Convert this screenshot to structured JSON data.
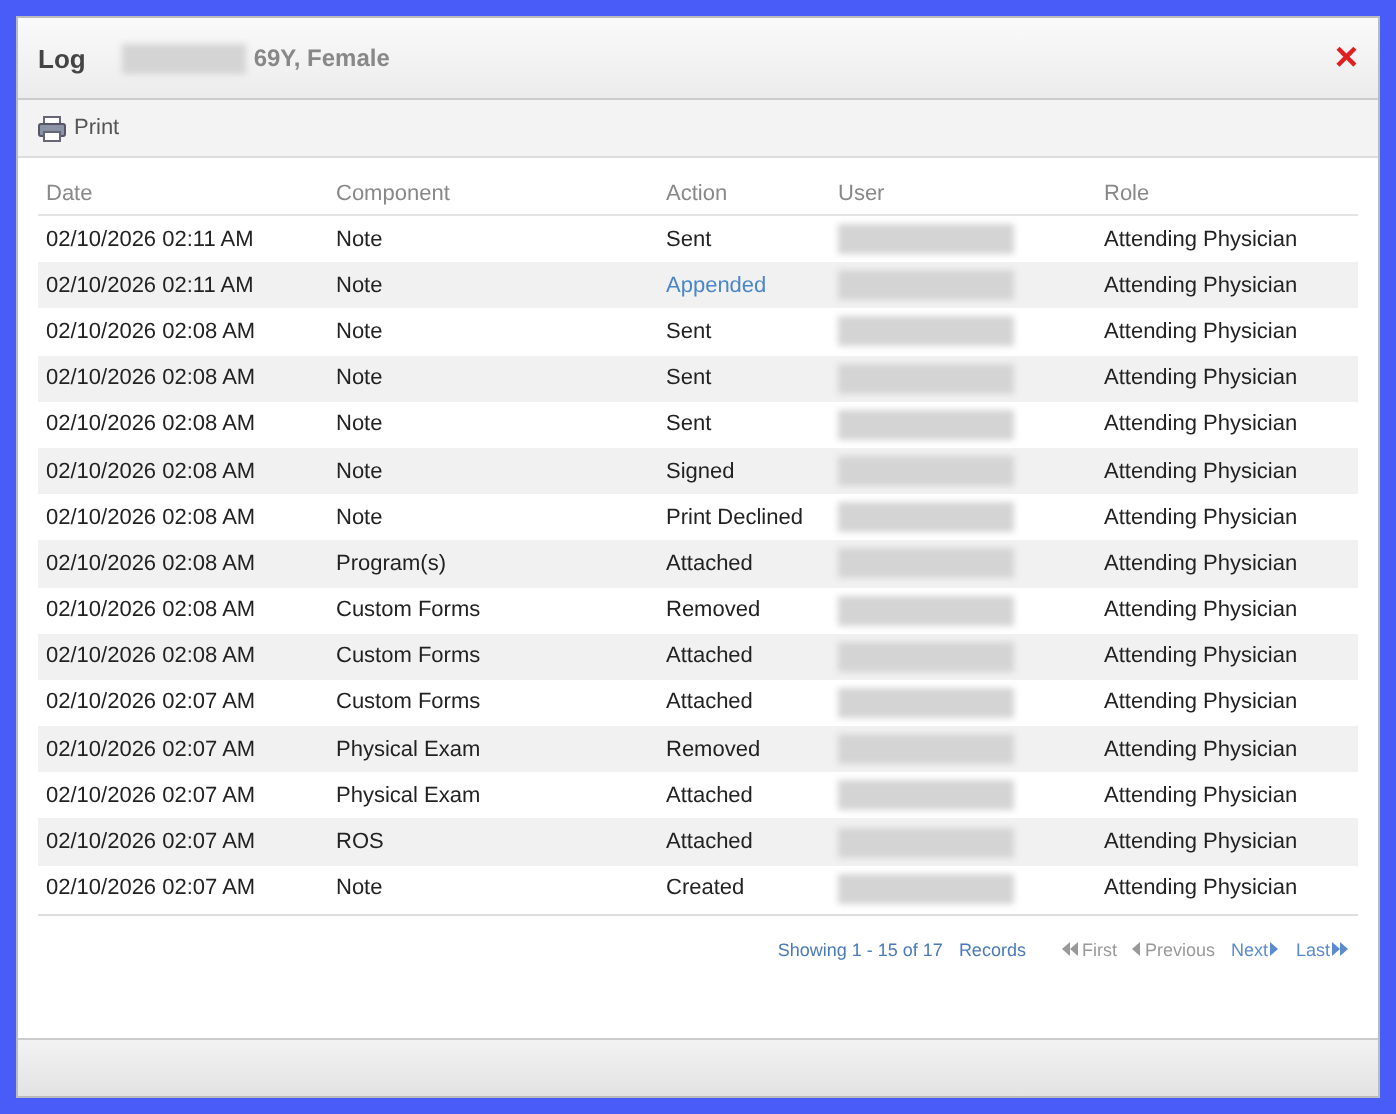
{
  "dialog": {
    "title": "Log",
    "patient": "69Y, Female",
    "close": "×"
  },
  "toolbar": {
    "print": "Print"
  },
  "table": {
    "columns": [
      "Date",
      "Component",
      "Action",
      "User",
      "Role"
    ],
    "rows": [
      {
        "date": "02/10/2026 02:11 AM",
        "component": "Note",
        "action": "Sent",
        "linked": false,
        "role": "Attending Physician"
      },
      {
        "date": "02/10/2026 02:11 AM",
        "component": "Note",
        "action": "Appended",
        "linked": true,
        "role": "Attending Physician"
      },
      {
        "date": "02/10/2026 02:08 AM",
        "component": "Note",
        "action": "Sent",
        "linked": false,
        "role": "Attending Physician"
      },
      {
        "date": "02/10/2026 02:08 AM",
        "component": "Note",
        "action": "Sent",
        "linked": false,
        "role": "Attending Physician"
      },
      {
        "date": "02/10/2026 02:08 AM",
        "component": "Note",
        "action": "Sent",
        "linked": false,
        "role": "Attending Physician"
      },
      {
        "date": "02/10/2026 02:08 AM",
        "component": "Note",
        "action": "Signed",
        "linked": false,
        "role": "Attending Physician"
      },
      {
        "date": "02/10/2026 02:08 AM",
        "component": "Note",
        "action": "Print Declined",
        "linked": false,
        "role": "Attending Physician"
      },
      {
        "date": "02/10/2026 02:08 AM",
        "component": "Program(s)",
        "action": "Attached",
        "linked": false,
        "role": "Attending Physician"
      },
      {
        "date": "02/10/2026 02:08 AM",
        "component": "Custom Forms",
        "action": "Removed",
        "linked": false,
        "role": "Attending Physician"
      },
      {
        "date": "02/10/2026 02:08 AM",
        "component": "Custom Forms",
        "action": "Attached",
        "linked": false,
        "role": "Attending Physician"
      },
      {
        "date": "02/10/2026 02:07 AM",
        "component": "Custom Forms",
        "action": "Attached",
        "linked": false,
        "role": "Attending Physician"
      },
      {
        "date": "02/10/2026 02:07 AM",
        "component": "Physical Exam",
        "action": "Removed",
        "linked": false,
        "role": "Attending Physician"
      },
      {
        "date": "02/10/2026 02:07 AM",
        "component": "Physical Exam",
        "action": "Attached",
        "linked": false,
        "role": "Attending Physician"
      },
      {
        "date": "02/10/2026 02:07 AM",
        "component": "ROS",
        "action": "Attached",
        "linked": false,
        "role": "Attending Physician"
      },
      {
        "date": "02/10/2026 02:07 AM",
        "component": "Note",
        "action": "Created",
        "linked": false,
        "role": "Attending Physician"
      }
    ]
  },
  "pager": {
    "summary": "Showing 1 - 15 of 17",
    "records": "Records",
    "links": [
      {
        "label": "First",
        "kind": "back",
        "disabled": true
      },
      {
        "label": "Previous",
        "kind": "prev",
        "disabled": true
      },
      {
        "label": "Next",
        "kind": "next",
        "disabled": false
      },
      {
        "label": "Last",
        "kind": "end",
        "disabled": false
      }
    ]
  }
}
